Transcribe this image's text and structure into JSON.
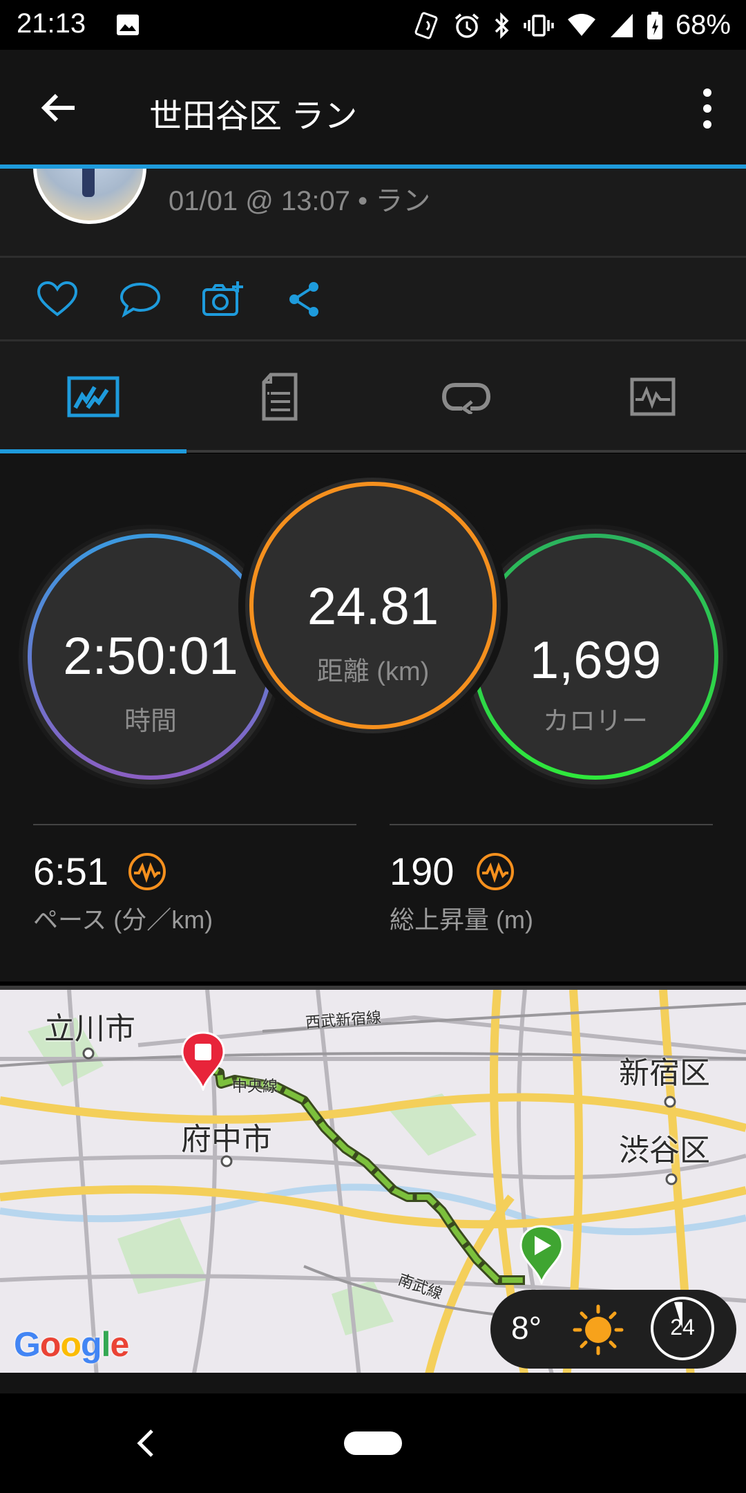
{
  "status_bar": {
    "time": "21:13",
    "battery": "68%",
    "icons": [
      "image-icon",
      "nfc-icon",
      "alarm-icon",
      "bluetooth-icon",
      "vibrate-icon",
      "wifi-icon",
      "signal-icon",
      "battery-icon"
    ]
  },
  "app_bar": {
    "title": "世田谷区 ラン"
  },
  "activity": {
    "meta": "01/01 @ 13:07 • ラン"
  },
  "actions": [
    "like-icon",
    "comment-icon",
    "add-photo-icon",
    "share-icon"
  ],
  "tabs": [
    "stats-tab",
    "details-tab",
    "laps-tab",
    "charts-tab"
  ],
  "stats": {
    "time": {
      "value": "2:50:01",
      "label": "時間"
    },
    "distance": {
      "value": "24.81",
      "label": "距離 (km)"
    },
    "calories": {
      "value": "1,699",
      "label": "カロリー"
    },
    "pace": {
      "value": "6:51",
      "label": "ペース (分／km)"
    },
    "ascent": {
      "value": "190",
      "label": "総上昇量 (m)"
    }
  },
  "map": {
    "labels": {
      "tachikawa": "立川市",
      "fuchu": "府中市",
      "shinjuku": "新宿区",
      "shibuya": "渋谷区",
      "seibu": "西武新宿線",
      "chuo": "中央線",
      "nambu": "南武線"
    },
    "attribution": "Google",
    "weather": {
      "temperature": "8°",
      "wind": "24"
    }
  },
  "colors": {
    "accent": "#1e9bdc",
    "time_ring": "#3b8fe0",
    "distance_ring": "#f5901e",
    "calories_ring": "#26d04a",
    "route": "#7cc03c"
  }
}
